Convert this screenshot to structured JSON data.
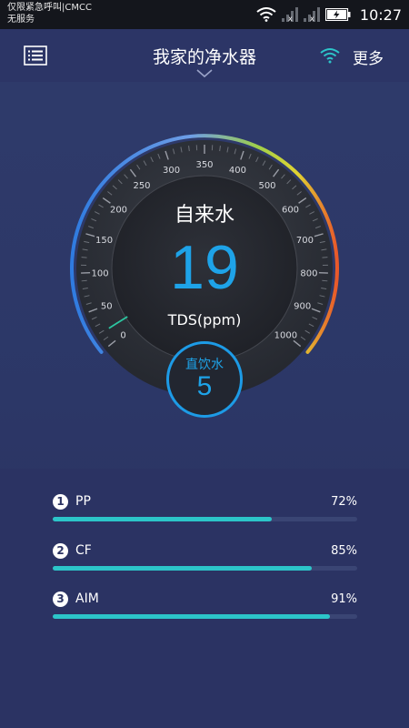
{
  "status_bar": {
    "carrier_line1": "仅限紧急呼叫|CMCC",
    "carrier_line2": "无服务",
    "time": "10:27",
    "icons": [
      "wifi-icon",
      "signal-icon",
      "signal-icon",
      "battery-charging-icon"
    ]
  },
  "header": {
    "title": "我家的净水器",
    "more_label": "更多",
    "icons": [
      "list-menu-icon",
      "chevron-down-icon",
      "wifi-icon"
    ]
  },
  "gauge": {
    "source_label": "自来水",
    "tds_value": "19",
    "unit": "TDS(ppm)",
    "scale_labels": [
      "0",
      "50",
      "100",
      "150",
      "200",
      "250",
      "300",
      "350",
      "400",
      "500",
      "600",
      "700",
      "800",
      "900",
      "1000"
    ],
    "needle_value": 19
  },
  "direct_water": {
    "label": "直饮水",
    "value": "5"
  },
  "filters": [
    {
      "number": "1",
      "name": "PP",
      "percent_text": "72%",
      "percent": 72
    },
    {
      "number": "2",
      "name": "CF",
      "percent_text": "85%",
      "percent": 85
    },
    {
      "number": "3",
      "name": "AIM",
      "percent_text": "91%",
      "percent": 91
    }
  ],
  "colors": {
    "accent_blue": "#1ea3e8",
    "progress_teal": "#2cc5c9",
    "background": "#2c3566"
  }
}
